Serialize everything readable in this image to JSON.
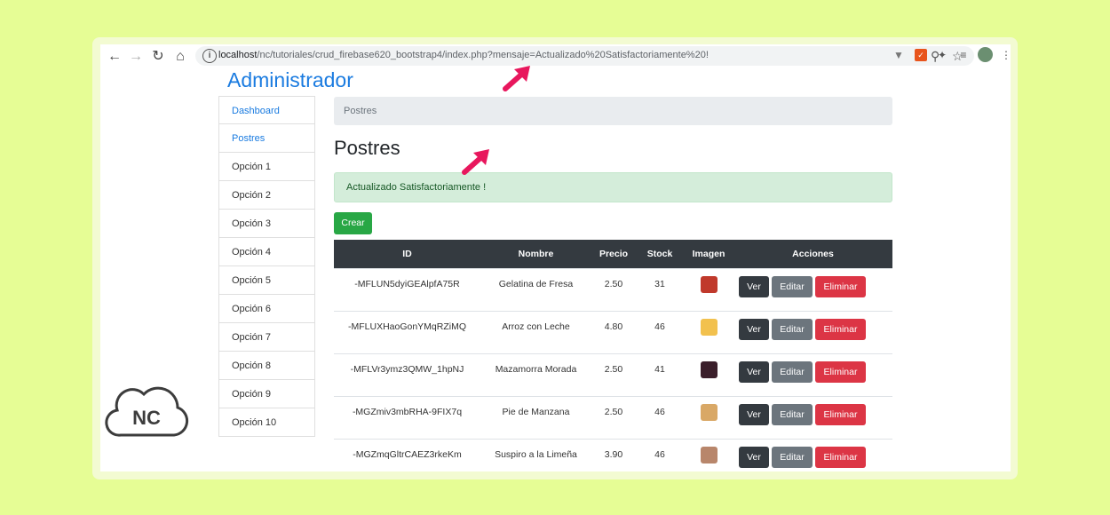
{
  "browser": {
    "url_host": "localhost",
    "url_path": "/nc/tutoriales/crud_firebase620_bootstrap4/index.php?mensaje=Actualizado%20Satisfactoriamente%20!"
  },
  "brand": {
    "logo_text": "NC"
  },
  "header": {
    "title": "Administrador"
  },
  "sidebar": {
    "items": [
      {
        "label": "Dashboard"
      },
      {
        "label": "Postres"
      },
      {
        "label": "Opción 1"
      },
      {
        "label": "Opción 2"
      },
      {
        "label": "Opción 3"
      },
      {
        "label": "Opción 4"
      },
      {
        "label": "Opción 5"
      },
      {
        "label": "Opción 6"
      },
      {
        "label": "Opción 7"
      },
      {
        "label": "Opción 8"
      },
      {
        "label": "Opción 9"
      },
      {
        "label": "Opción 10"
      }
    ]
  },
  "main": {
    "breadcrumb": "Postres",
    "title": "Postres",
    "alert": "Actualizado Satisfactoriamente !",
    "create_label": "Crear",
    "columns": [
      "ID",
      "Nombre",
      "Precio",
      "Stock",
      "Imagen",
      "Acciones"
    ],
    "action_labels": {
      "view": "Ver",
      "edit": "Editar",
      "delete": "Eliminar"
    },
    "rows": [
      {
        "id": "-MFLUN5dyiGEAlpfA75R",
        "nombre": "Gelatina de Fresa",
        "precio": "2.50",
        "stock": "31",
        "img_color": "#c0392b"
      },
      {
        "id": "-MFLUXHaoGonYMqRZiMQ",
        "nombre": "Arroz con Leche",
        "precio": "4.80",
        "stock": "46",
        "img_color": "#f2c14e"
      },
      {
        "id": "-MFLVr3ymz3QMW_1hpNJ",
        "nombre": "Mazamorra Morada",
        "precio": "2.50",
        "stock": "41",
        "img_color": "#3b1f2b"
      },
      {
        "id": "-MGZmiv3mbRHA-9FIX7q",
        "nombre": "Pie de Manzana",
        "precio": "2.50",
        "stock": "46",
        "img_color": "#d9a866"
      },
      {
        "id": "-MGZmqGltrCAEZ3rkeKm",
        "nombre": "Suspiro a la Limeña",
        "precio": "3.90",
        "stock": "46",
        "img_color": "#b8866b"
      }
    ]
  },
  "colors": {
    "background": "#e6fd95",
    "accent_arrow": "#e8175d",
    "primary": "#1a7be0",
    "success": "#28a745",
    "danger": "#dc3545",
    "secondary": "#6c757d",
    "dark": "#343a40"
  }
}
